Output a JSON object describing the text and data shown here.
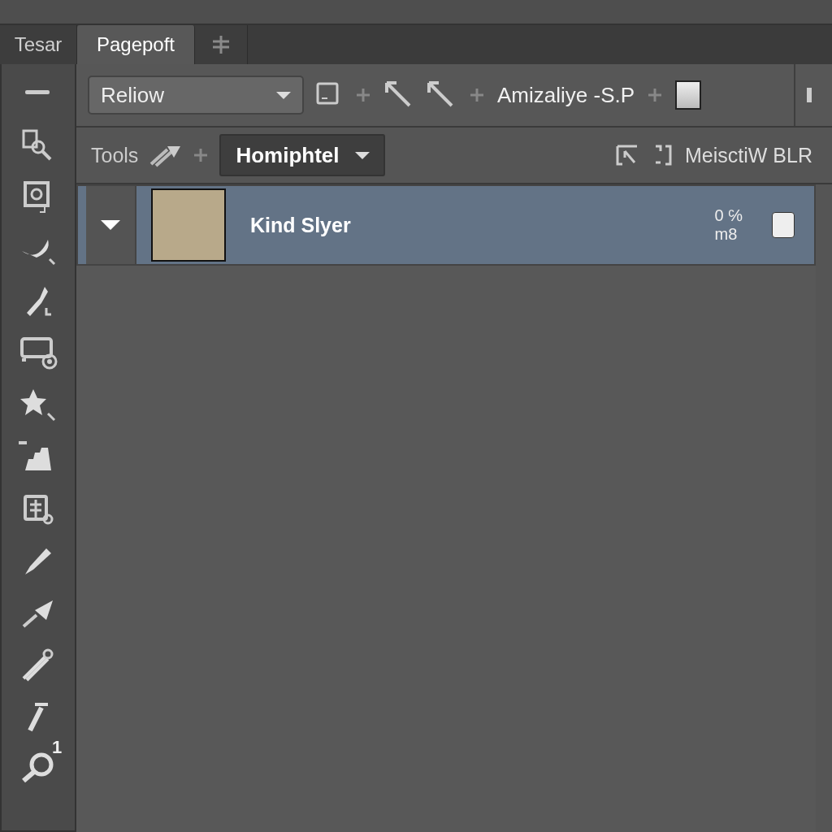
{
  "tabs": [
    {
      "label": "Tesar",
      "selected": false
    },
    {
      "label": "Pagepoft",
      "selected": true
    }
  ],
  "options_bar": {
    "preset": "Reliow",
    "label": "Amizaliye -S.P"
  },
  "tools_bar": {
    "label": "Tools",
    "mode": "Homiphtel",
    "status": "MeisctiW BLR"
  },
  "layers": [
    {
      "name": "Kind Slyer",
      "expanded": true,
      "selected": true,
      "info_1": "0 ℅",
      "info_2": "m8",
      "checked": false
    }
  ],
  "toolbar": {
    "badge": "1"
  }
}
